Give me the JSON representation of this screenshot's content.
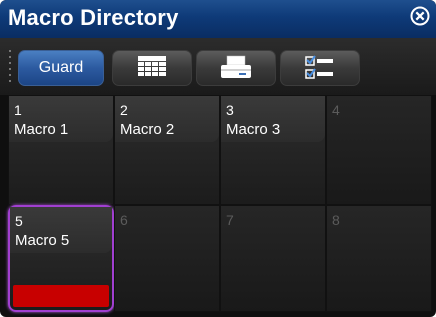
{
  "window": {
    "title": "Macro Directory"
  },
  "toolbar": {
    "guard_label": "Guard",
    "buttons": [
      {
        "icon": "table-icon"
      },
      {
        "icon": "printer-icon"
      },
      {
        "icon": "checklist-icon"
      }
    ]
  },
  "macros": [
    {
      "number": "1",
      "name": "Macro 1"
    },
    {
      "number": "2",
      "name": "Macro 2"
    },
    {
      "number": "3",
      "name": "Macro 3"
    },
    {
      "number": "4",
      "name": ""
    },
    {
      "number": "5",
      "name": "Macro 5"
    },
    {
      "number": "6",
      "name": ""
    },
    {
      "number": "7",
      "name": ""
    },
    {
      "number": "8",
      "name": ""
    }
  ],
  "selected_macro": "5",
  "colors": {
    "title_bar": "#0e3a78",
    "selection_border": "#a13fd1",
    "running_indicator": "#c80000"
  }
}
